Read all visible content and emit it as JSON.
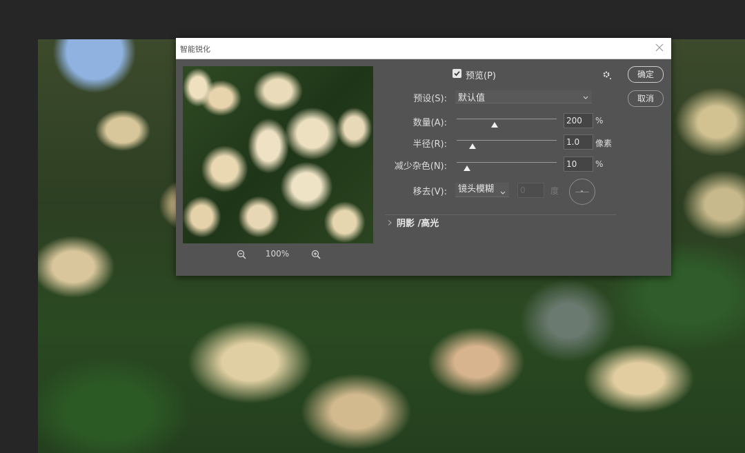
{
  "dialog": {
    "title": "智能锐化",
    "zoom_level": "100%",
    "preview_label": "预览(P)",
    "preview_checked": true,
    "ok_label": "确定",
    "cancel_label": "取消",
    "preset": {
      "label": "预设(S):",
      "value": "默认值"
    },
    "amount": {
      "label": "数量(A):",
      "value": "200",
      "unit": "%",
      "slider_fraction": 0.38
    },
    "radius": {
      "label": "半径(R):",
      "value": "1.0",
      "unit": "像素",
      "slider_fraction": 0.16
    },
    "noise": {
      "label": "减少杂色(N):",
      "value": "10",
      "unit": "%",
      "slider_fraction": 0.1
    },
    "remove": {
      "label": "移去(V):",
      "value": "镜头模糊",
      "angle": "0",
      "angle_unit": "度"
    },
    "section_label": "阴影 /高光"
  },
  "icons": {
    "close": "close-icon",
    "gear": "gear-icon",
    "zoom_out": "zoom-out-icon",
    "zoom_in": "zoom-in-icon",
    "checkbox": "checkmark-icon",
    "chevron": "chevron-down-icon",
    "expand": "chevron-right-icon"
  },
  "colors": {
    "dialog_bg": "#535353",
    "workspace_bg": "#262626",
    "titlebar_bg": "#ffffff"
  }
}
